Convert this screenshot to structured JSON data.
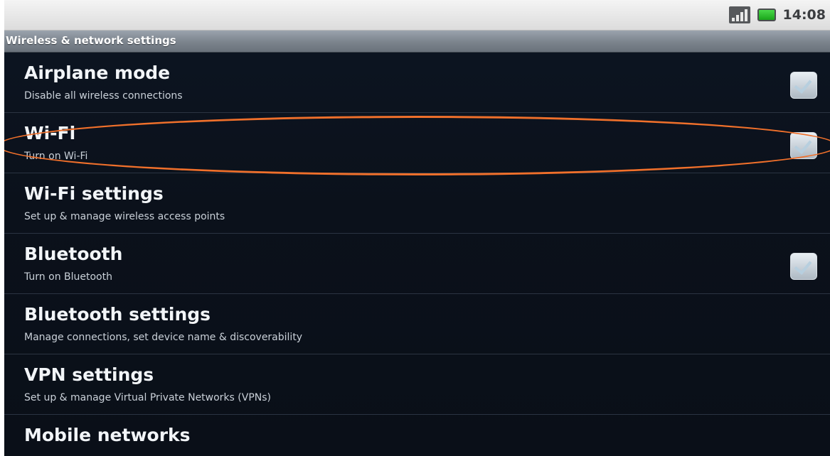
{
  "status_bar": {
    "time": "14:08",
    "icons": [
      "signal-icon",
      "battery-icon"
    ]
  },
  "title_bar": {
    "title": "Wireless & network settings"
  },
  "settings": [
    {
      "title": "Airplane mode",
      "subtitle": "Disable all wireless connections",
      "has_checkbox": true
    },
    {
      "title": "Wi-Fi",
      "subtitle": "Turn on Wi-Fi",
      "has_checkbox": true,
      "highlighted": true
    },
    {
      "title": "Wi-Fi settings",
      "subtitle": "Set up & manage wireless access points",
      "has_checkbox": false
    },
    {
      "title": "Bluetooth",
      "subtitle": "Turn on Bluetooth",
      "has_checkbox": true
    },
    {
      "title": "Bluetooth settings",
      "subtitle": "Manage connections, set device name & discoverability",
      "has_checkbox": false
    },
    {
      "title": "VPN settings",
      "subtitle": "Set up & manage Virtual Private Networks (VPNs)",
      "has_checkbox": false
    },
    {
      "title": "Mobile networks",
      "subtitle": "",
      "has_checkbox": false
    }
  ],
  "colors": {
    "background": "#0b111b",
    "title_bar": "#7b838c",
    "highlight": "#f0702b",
    "text_primary": "#f2f5f8",
    "text_secondary": "#c9d0d8"
  }
}
